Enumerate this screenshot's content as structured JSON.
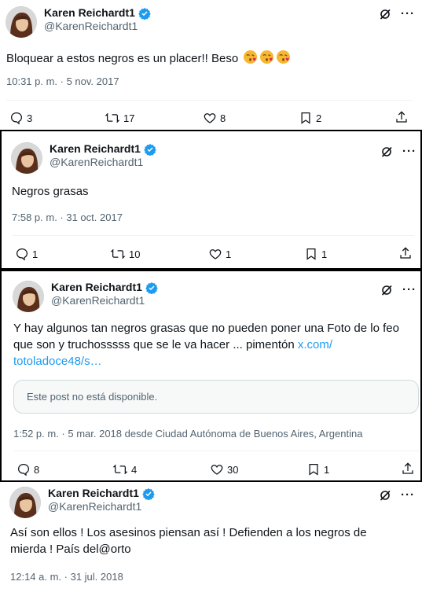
{
  "tweets": [
    {
      "name": "Karen Reichardt1",
      "handle": "@KarenReichardt1",
      "text": "Bloquear a estos negros es un placer!! Beso",
      "emoji": [
        "face-blowing-kiss",
        "face-blowing-kiss",
        "face-blowing-kiss"
      ],
      "meta": "10:31 p. m. · 5 nov. 2017",
      "replies": "3",
      "retweets": "17",
      "likes": "8",
      "bookmarks": "2"
    },
    {
      "name": "Karen Reichardt1",
      "handle": "@KarenReichardt1",
      "text": "Negros grasas",
      "meta": "7:58 p. m. · 31 oct. 2017",
      "replies": "1",
      "retweets": "10",
      "likes": "1",
      "bookmarks": "1"
    },
    {
      "name": "Karen Reichardt1",
      "handle": "@KarenReichardt1",
      "text_line1": "Y hay algunos tan negros grasas que no pueden poner una Foto de lo feo",
      "text_line2": "que son y truchosssss que se le va hacer ... pimentón ",
      "link_part1": "x.com/",
      "link_part2": "totoladoce48/s…",
      "quote": "Este post no está disponible.",
      "meta": "1:52 p. m. · 5 mar. 2018 desde Ciudad Autónoma de Buenos Aires, Argentina",
      "replies": "8",
      "retweets": "4",
      "likes": "30",
      "bookmarks": "1"
    },
    {
      "name": "Karen Reichardt1",
      "handle": "@KarenReichardt1",
      "text_line1": "Así son ellos ! Los asesinos piensan así ! Defienden a los negros de",
      "text_line2": "mierda ! País del@orto",
      "meta": "12:14 a. m. · 31 jul. 2018"
    }
  ],
  "icons": {
    "verified": "verified-badge-icon",
    "grok": "grok-icon",
    "more": "more-icon",
    "reply": "reply-icon",
    "retweet": "retweet-icon",
    "like": "heart-icon",
    "bookmark": "bookmark-icon",
    "share": "share-icon"
  },
  "colors": {
    "accent": "#1d9bf0",
    "text": "#0f1419",
    "muted": "#536471"
  }
}
